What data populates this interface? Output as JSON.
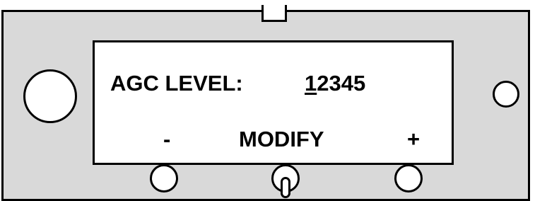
{
  "display": {
    "label": "AGC LEVEL:",
    "value_cursor_digit": "1",
    "value_rest": "2345",
    "softkeys": {
      "left": "-",
      "center": "MODIFY",
      "right": "+"
    }
  },
  "colors": {
    "panel": "#d9d9d9",
    "screen": "#ffffff",
    "outline": "#000000"
  }
}
